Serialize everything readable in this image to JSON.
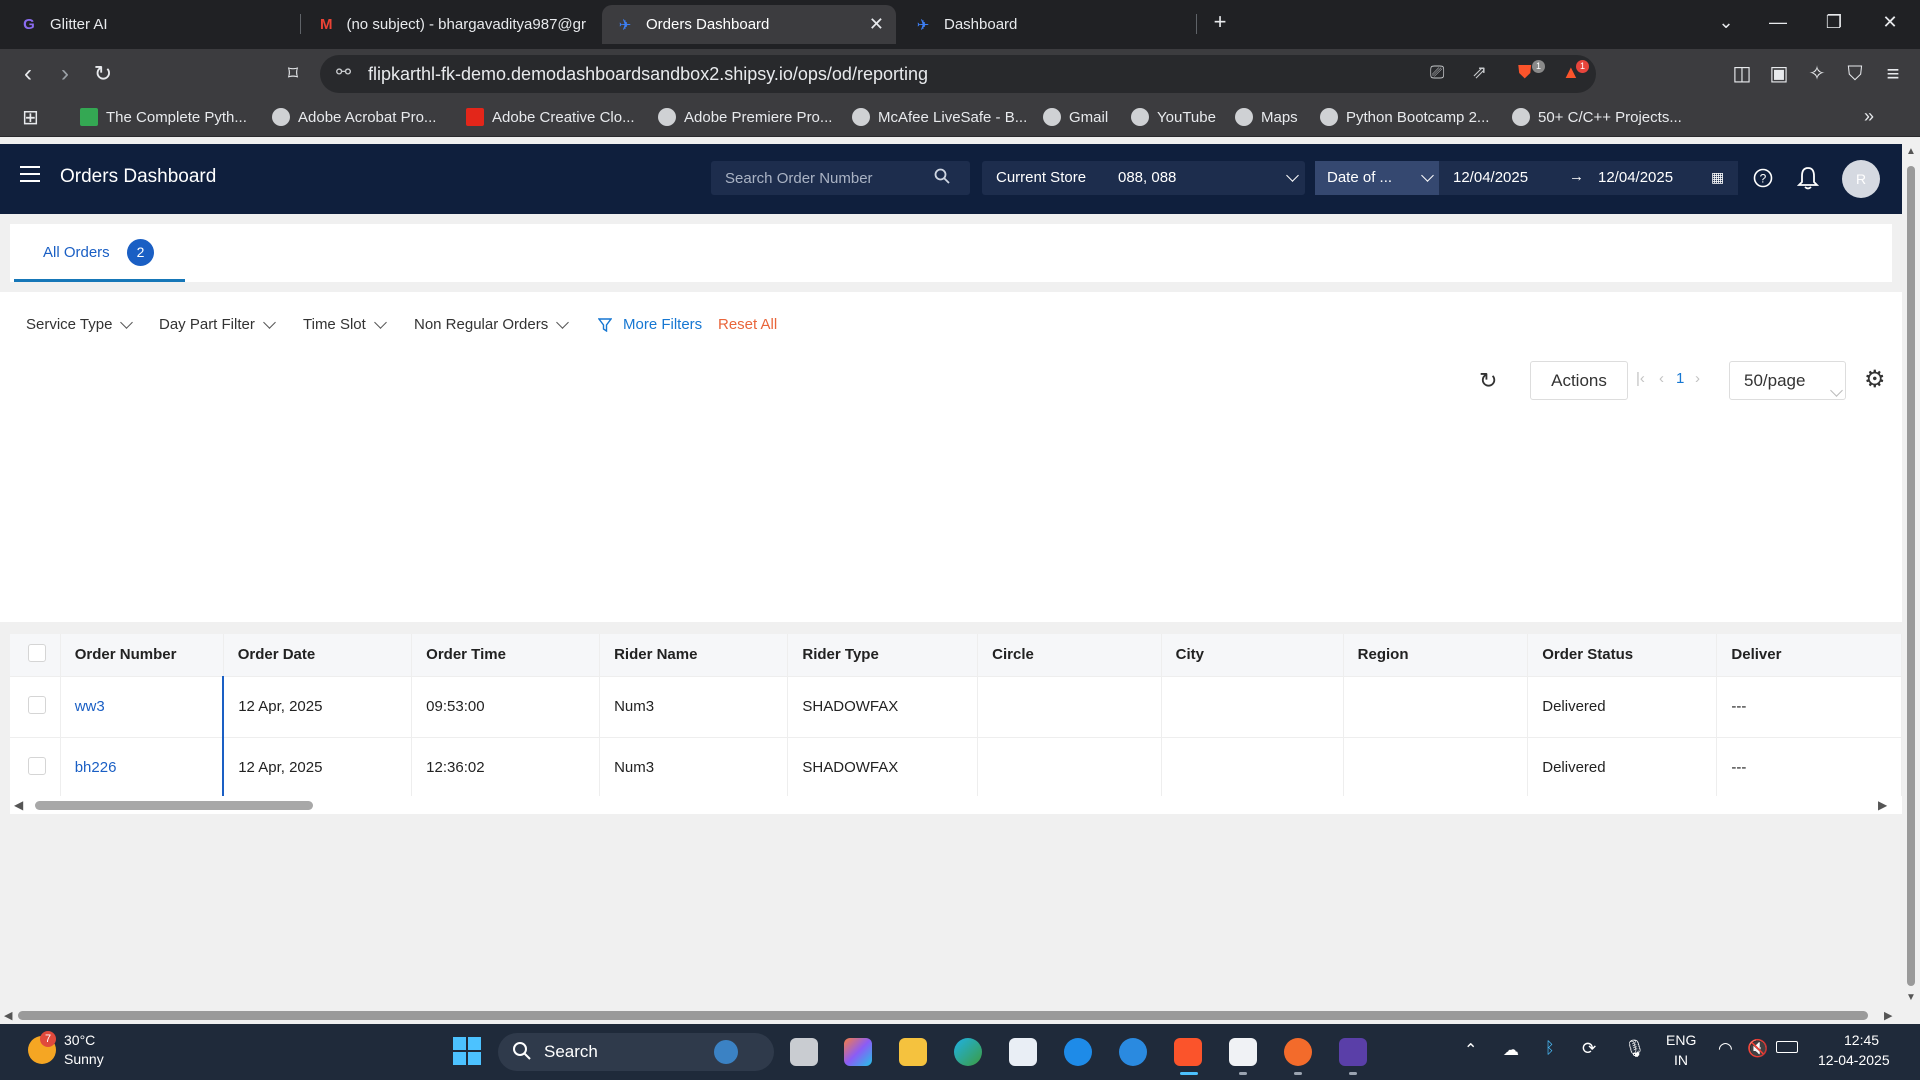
{
  "browser": {
    "tabs": [
      {
        "title": "Glitter AI",
        "icon": "glitter-icon"
      },
      {
        "title": "(no subject) - bhargavaditya987@gr",
        "icon": "gmail-icon"
      },
      {
        "title": "Orders Dashboard",
        "icon": "shipsy-icon",
        "active": true
      },
      {
        "title": "Dashboard",
        "icon": "shipsy-icon"
      }
    ],
    "url": "flipkarthl-fk-demo.demodashboardsandbox2.shipsy.io/ops/od/reporting",
    "brave_badge": "1",
    "alert_badge": "1",
    "bookmarks": [
      "The Complete Pyth...",
      "Adobe Acrobat Pro...",
      "Adobe Creative Clo...",
      "Adobe Premiere Pro...",
      "McAfee LiveSafe - B...",
      "Gmail",
      "YouTube",
      "Maps",
      "Python Bootcamp 2...",
      "50+ C/C++ Projects..."
    ]
  },
  "header": {
    "title": "Orders Dashboard",
    "search_placeholder": "Search Order Number",
    "store_label": "Current Store",
    "store_value": "088, 088",
    "date_type": "Date of ...",
    "date_from": "12/04/2025",
    "date_to": "12/04/2025",
    "avatar_initial": "R"
  },
  "tabs": {
    "all_orders_label": "All Orders",
    "all_orders_count": "2"
  },
  "filters": {
    "service_type": "Service Type",
    "day_part": "Day Part Filter",
    "time_slot": "Time Slot",
    "non_regular": "Non Regular Orders",
    "more_filters": "More Filters",
    "reset_all": "Reset All"
  },
  "toolbar": {
    "actions_label": "Actions",
    "current_page": "1",
    "page_size": "50/page"
  },
  "table": {
    "columns": [
      "Order Number",
      "Order Date",
      "Order Time",
      "Rider Name",
      "Rider Type",
      "Circle",
      "City",
      "Region",
      "Order Status",
      "Deliver"
    ],
    "rows": [
      [
        "ww3",
        "12 Apr, 2025",
        "09:53:00",
        "Num3",
        "SHADOWFAX",
        "",
        "",
        "",
        "Delivered",
        "---"
      ],
      [
        "bh226",
        "12 Apr, 2025",
        "12:36:02",
        "Num3",
        "SHADOWFAX",
        "",
        "",
        "",
        "Delivered",
        "---"
      ]
    ]
  },
  "taskbar": {
    "weather_badge": "7",
    "temperature": "30°C",
    "condition": "Sunny",
    "search_label": "Search",
    "lang_top": "ENG",
    "lang_bottom": "IN",
    "time": "12:45",
    "date": "12-04-2025"
  },
  "colors": {
    "app_header": "#0f1f3d",
    "accent": "#1a5fc4",
    "reset": "#e9653a"
  }
}
